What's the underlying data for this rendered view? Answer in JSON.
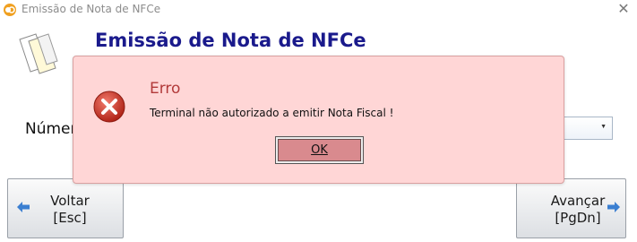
{
  "window": {
    "title": "Emissão de Nota de NFCe",
    "close_glyph": "✕"
  },
  "main": {
    "heading": "Emissão de Nota de NFCe",
    "field_label": "Númer"
  },
  "buttons": {
    "back": {
      "line1": "Voltar",
      "line2": "[Esc]"
    },
    "next": {
      "line1": "Avançar",
      "line2": "[PgDn]"
    }
  },
  "dialog": {
    "title": "Erro",
    "message": "Terminal não autorizado a emitir Nota Fiscal !",
    "ok_label": "OK"
  },
  "colors": {
    "heading": "#1a1a8c",
    "dialog_bg": "#ffd6d6",
    "dialog_title": "#b23a3a",
    "error_icon": "#c8372b",
    "ok_button": "#d98a8e",
    "arrow": "#3b7fd1"
  },
  "icons": {
    "app": "app-logo-icon",
    "document": "documents-icon",
    "error": "error-x-icon",
    "back": "arrow-left-icon",
    "next": "arrow-right-icon",
    "close": "close-icon"
  }
}
